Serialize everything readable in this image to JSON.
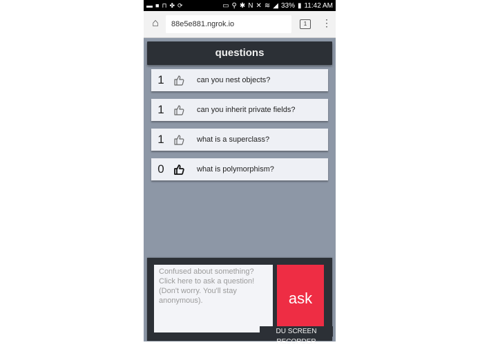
{
  "status_bar": {
    "battery": "33%",
    "time": "11:42 AM"
  },
  "browser": {
    "url": "88e5e881.ngrok.io",
    "tab_count": "1"
  },
  "page": {
    "title": "questions",
    "questions": [
      {
        "count": "1",
        "text": "can you nest objects?",
        "liked": false
      },
      {
        "count": "1",
        "text": "can you inherit private fields?",
        "liked": false
      },
      {
        "count": "1",
        "text": "what is a superclass?",
        "liked": false
      },
      {
        "count": "0",
        "text": "what is polymorphism?",
        "liked": true
      }
    ],
    "ask_placeholder": "Confused about something? Click here to ask a question! (Don't worry. You'll stay anonymous).",
    "ask_button": "ask"
  },
  "watermark": "DU SCREEN RECORDER",
  "colors": {
    "background": "#8d97a6",
    "header": "#2c3036",
    "card": "#eef0f5",
    "ask_button": "#ee2d44"
  }
}
